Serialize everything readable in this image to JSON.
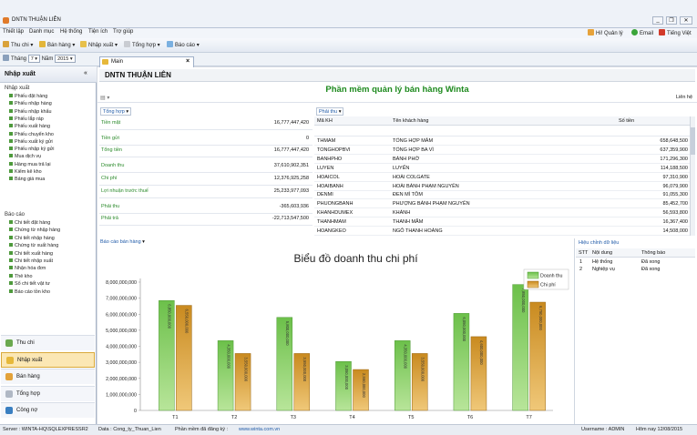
{
  "window": {
    "title": "DNTN THUẬN LIÊN"
  },
  "menu": [
    "Thiết lập",
    "Danh mục",
    "Hệ thống",
    "Tiện ích",
    "Trợ giúp"
  ],
  "user_area": {
    "greeting": "Hi! Quản lý",
    "email": "Email",
    "language": "Tiếng Việt"
  },
  "toolbar": [
    "Thu chi",
    "Bán hàng",
    "Nhập xuất",
    "Tổng hợp",
    "Báo cáo"
  ],
  "period": {
    "month_label": "Tháng",
    "month": "7",
    "year_label": "Năm",
    "year": "2015"
  },
  "sidebar": {
    "header": "Nhập xuất",
    "group1": "Nhập xuất",
    "items1": [
      "Phiếu đặt hàng",
      "Phiếu nhập hàng",
      "Phiếu nhập khẩu",
      "Phiếu lắp ráp",
      "Phiếu xuất hàng",
      "Phiếu chuyển kho",
      "Phiếu xuất ký gửi",
      "Phiếu nhập ký gửi",
      "Mua dịch vụ",
      "Hàng mua trả lại",
      "Kiểm kê kho",
      "Bảng giá mua"
    ],
    "group2": "Báo cáo",
    "items2": [
      "Chi tiết đặt hàng",
      "Chứng từ nhập hàng",
      "Chi tiết nhập hàng",
      "Chứng từ xuất hàng",
      "Chi tiết xuất hàng",
      "Chi tiết nhập xuất",
      "Nhận hóa đơn",
      "Thẻ kho",
      "Sổ chi tiết vật tư",
      "Báo cáo tồn kho"
    ],
    "nav": [
      "Thu chi",
      "Nhập xuất",
      "Bán hàng",
      "Tổng hợp",
      "Công nợ"
    ]
  },
  "tab": {
    "label": "Main"
  },
  "company": "DNTN THUẬN LIÊN",
  "app_title": "Phần mềm quản lý bán hàng Winta",
  "contact": "Liên hệ",
  "summary": {
    "dropdown": "Tổng hợp",
    "rows": [
      {
        "label": "Tiền mặt",
        "value": "16,777,447,420"
      },
      {
        "label": "Tiền gửi",
        "value": "0"
      },
      {
        "label": "Tổng tiền",
        "value": "16,777,447,420"
      },
      {
        "label": "Doanh thu",
        "value": "37,610,902,351"
      },
      {
        "label": "Chi phí",
        "value": "12,376,925,258"
      },
      {
        "label": "Lợi nhuận trước thuế",
        "value": "25,233,977,093"
      },
      {
        "label": "Phải thu",
        "value": "-365,603,936"
      },
      {
        "label": "Phải trả",
        "value": "-22,713,547,500"
      }
    ]
  },
  "receivables": {
    "dropdown": "Phải thu",
    "headers": [
      "Mã KH",
      "Tên khách hàng",
      "Số tiền"
    ],
    "rows": [
      [
        "THMAM",
        "TỔNG HỢP MÂM",
        "658,648,500"
      ],
      [
        "TONGHOPBVI",
        "TỔNG HỢP BA VÌ",
        "637,359,900"
      ],
      [
        "BANHPHO",
        "BÁNH PHỞ",
        "171,296,300"
      ],
      [
        "LUYEN",
        "LUYẾN",
        "114,188,500"
      ],
      [
        "HOAICOL",
        "HOÀI COLGATE",
        "97,310,900"
      ],
      [
        "HOAIBANH",
        "HOÀI BÁNH PHẠM NGUYÊN",
        "96,079,900"
      ],
      [
        "DENMI",
        "ĐEN MÌ TÔM",
        "91,055,300"
      ],
      [
        "PHUONGBANH",
        "PHƯỢNG BÁNH PHẠM NGUYÊN",
        "85,452,700"
      ],
      [
        "KHANHDUMEX",
        "KHÁNH",
        "56,593,800"
      ],
      [
        "THANHMAM",
        "THANH MẮM",
        "16,367,400"
      ],
      [
        "HOANGKEO",
        "NGÔ THANH HOÀNG",
        "14,508,000"
      ]
    ]
  },
  "sales_report": {
    "dropdown": "Báo cáo bán hàng"
  },
  "chart_data": {
    "type": "bar",
    "title": "Biểu đồ doanh thu chi phí",
    "categories": [
      "T1",
      "T2",
      "T3",
      "T4",
      "T5",
      "T6",
      "T7"
    ],
    "series": [
      {
        "name": "Doanh thu",
        "color": "#6cc04a",
        "values": [
          6850000000,
          4350000000,
          5800000000,
          3050000000,
          4350000000,
          6050000000,
          7850000000
        ]
      },
      {
        "name": "Chi phí",
        "color": "#c98a1f",
        "values": [
          6550000000,
          3550000000,
          3550000000,
          2550000000,
          3550000000,
          4600000000,
          6750000000
        ]
      }
    ],
    "yticks": [
      "0",
      "1,000,000,000",
      "2,000,000,000",
      "3,000,000,000",
      "4,000,000,000",
      "5,000,000,000",
      "6,000,000,000",
      "7,000,000,000",
      "8,000,000,000"
    ],
    "ylim": [
      0,
      8000000000
    ],
    "legend": "top-right"
  },
  "data_edit": {
    "title": "Hiệu chỉnh dữ liệu",
    "headers": [
      "STT",
      "Nội dung",
      "Thông báo"
    ],
    "rows": [
      [
        "1",
        "Hệ thống",
        "Đã xong"
      ],
      [
        "2",
        "Nghiệp vụ",
        "Đã xong"
      ]
    ]
  },
  "status": {
    "server": "Server : WINTA-HQ\\SQLEXPRESSR2",
    "data": "Data : Cong_ty_Thuan_Lien",
    "registered": "Phần mềm đã đăng ký :",
    "website": "www.winta.com.vn",
    "username": "Username : ADMIN",
    "date": "Hôm nay 12/08/2015"
  }
}
